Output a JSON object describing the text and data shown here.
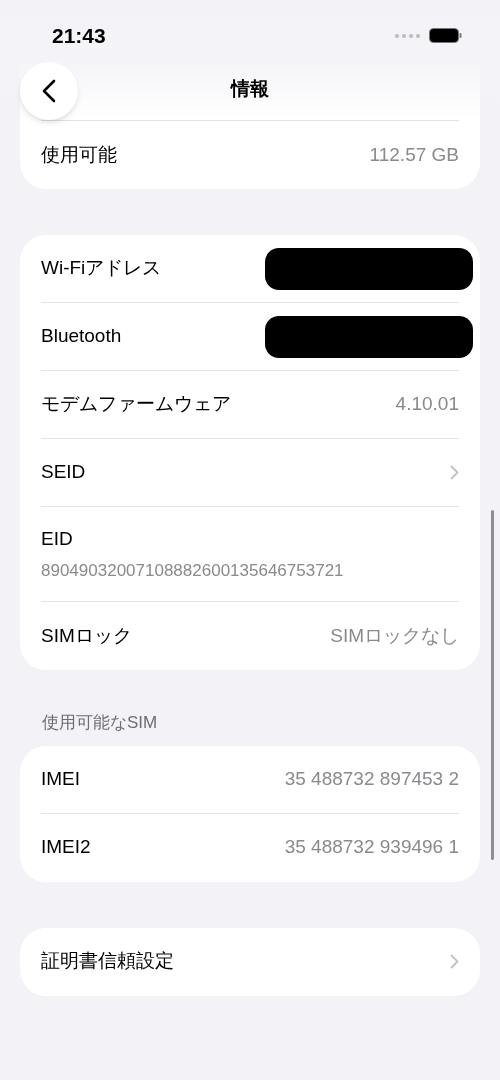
{
  "status_bar": {
    "time": "21:43"
  },
  "nav": {
    "title": "情報"
  },
  "storage": [
    {
      "label": "使用可能",
      "value": "112.57 GB"
    }
  ],
  "info": [
    {
      "kind": "redacted",
      "label": "Wi-Fiアドレス"
    },
    {
      "kind": "redacted",
      "label": "Bluetooth"
    },
    {
      "kind": "value",
      "label": "モデムファームウェア",
      "value": "4.10.01"
    },
    {
      "kind": "link",
      "label": "SEID"
    },
    {
      "kind": "stacked",
      "label": "EID",
      "value": "89049032007108882600135646753721"
    },
    {
      "kind": "value",
      "label": "SIMロック",
      "value": "SIMロックなし"
    }
  ],
  "sim_section": {
    "header": "使用可能なSIM",
    "rows": [
      {
        "kind": "value",
        "label": "IMEI",
        "value": "35 488732 897453 2"
      },
      {
        "kind": "value",
        "label": "IMEI2",
        "value": "35 488732 939496 1"
      }
    ]
  },
  "trust": [
    {
      "kind": "link",
      "label": "証明書信頼設定"
    }
  ]
}
